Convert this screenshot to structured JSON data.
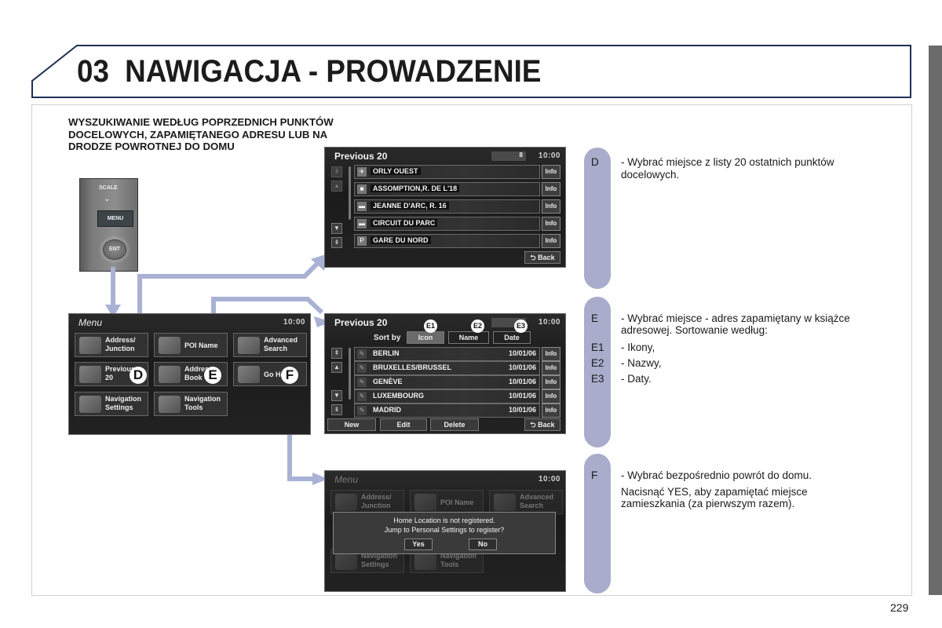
{
  "header": {
    "chapter_number": "03",
    "title": "NAWIGACJA - PROWADZENIE"
  },
  "section_heading": "WYSZUKIWANIE WEDŁUG POPRZEDNICH PUNKTÓW DOCELOWYCH, ZAPAMIĘTANEGO ADRESU LUB NA DRODZE POWROTNEJ DO DOMU",
  "dial": {
    "scale_label": "SCALE",
    "menu_label": "MENU",
    "ent_label": "ENT",
    "chevron_icon": "chevron-down-icon"
  },
  "screen_previous20": {
    "title": "Previous 20",
    "counter": "8",
    "clock": "10:00",
    "items": [
      {
        "icon": "plane-icon",
        "icon_glyph": "✈",
        "label": "ORLY OUEST",
        "info": "Info"
      },
      {
        "icon": "poi-icon",
        "icon_glyph": "■",
        "label": "ASSOMPTION,R. DE L'18",
        "info": "Info"
      },
      {
        "icon": "poi-icon",
        "icon_glyph": "▬",
        "label": "JEANNE D'ARC, R. 16",
        "info": "Info"
      },
      {
        "icon": "poi-icon",
        "icon_glyph": "▬",
        "label": "CIRCUIT DU PARC",
        "info": "Info"
      },
      {
        "icon": "parking-icon",
        "icon_glyph": "P",
        "label": "GARE DU NORD",
        "info": "Info"
      }
    ],
    "back_label": "Back"
  },
  "screen_menu": {
    "title": "Menu",
    "clock": "10:00",
    "tiles": [
      {
        "label": "Address/\nJunction"
      },
      {
        "label": "POI Name"
      },
      {
        "label": "Advanced\nSearch"
      },
      {
        "label": "Previous\n20"
      },
      {
        "label": "Address\nBook"
      },
      {
        "label": "Go Home"
      },
      {
        "label": "Navigation\nSettings"
      },
      {
        "label": "Navigation\nTools"
      }
    ]
  },
  "screen_address_book": {
    "title": "Previous 20",
    "clock": "10:00",
    "sort_by_label": "Sort by",
    "sort_options": [
      "Icon",
      "Name",
      "Date"
    ],
    "rows": [
      {
        "label": "BERLIN",
        "date": "10/01/06",
        "info": "Info"
      },
      {
        "label": "BRUXELLES/BRUSSEL",
        "date": "10/01/06",
        "info": "Info"
      },
      {
        "label": "GENÈVE",
        "date": "10/01/06",
        "info": "Info"
      },
      {
        "label": "LUXEMBOURG",
        "date": "10/01/06",
        "info": "Info"
      },
      {
        "label": "MADRID",
        "date": "10/01/06",
        "info": "Info"
      }
    ],
    "buttons": {
      "new": "New",
      "edit": "Edit",
      "delete": "Delete",
      "back": "Back"
    }
  },
  "screen_go_home": {
    "title": "Menu",
    "clock": "10:00",
    "dialog_line1": "Home Location is not registered.",
    "dialog_line2": "Jump to Personal Settings to register?",
    "yes_label": "Yes",
    "no_label": "No"
  },
  "callouts": {
    "d": "D",
    "e": "E",
    "f": "F",
    "e1": "E1",
    "e2": "E2",
    "e3": "E3"
  },
  "descriptions": {
    "d": {
      "key": "D",
      "line1": "- Wybrać miejsce z listy 20 ostatnich punktów",
      "line2": "docelowych."
    },
    "e": {
      "key": "E",
      "line1": "- Wybrać miejsce - adres zapamiętany w książce",
      "line2": "adresowej. Sortowanie według:",
      "e1_key": "E1",
      "e1_text": "- Ikony,",
      "e2_key": "E2",
      "e2_text": "- Nazwy,",
      "e3_key": "E3",
      "e3_text": "- Daty."
    },
    "f": {
      "key": "F",
      "line1": "- Wybrać bezpośrednio powrót do domu.",
      "line2": "Nacisnąć YES, aby zapamiętać miejsce",
      "line3": "zamieszkania (za pierwszym razem)."
    }
  },
  "colors": {
    "accent_arrow": "#a9b2d4",
    "pill": "#a9adcb",
    "header_border": "#1f2f55",
    "side_tab": "#6b6b6b"
  },
  "page_number": "229"
}
